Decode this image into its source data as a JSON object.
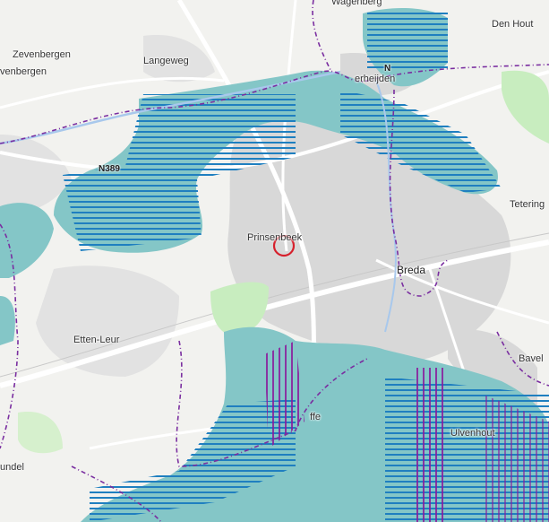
{
  "map": {
    "places": [
      {
        "id": "wagenberg",
        "name": "Wagenberg"
      },
      {
        "id": "den-hout",
        "name": "Den Hout"
      },
      {
        "id": "zevenbergen",
        "name": "Zevenbergen"
      },
      {
        "id": "langeweg",
        "name": "Langeweg"
      },
      {
        "id": "zevenbergen-partial",
        "name": "venbergen"
      },
      {
        "id": "terheijden",
        "name": "erheijden"
      },
      {
        "id": "teteringen",
        "name": "Tetering"
      },
      {
        "id": "prinsenbeek",
        "name": "Prinsenbeek"
      },
      {
        "id": "breda",
        "name": "Breda"
      },
      {
        "id": "etten-leur",
        "name": "Etten-Leur"
      },
      {
        "id": "bavel",
        "name": "Bavel"
      },
      {
        "id": "effen",
        "name": "ffe"
      },
      {
        "id": "ulvenhout",
        "name": "Ulvenhout"
      },
      {
        "id": "rucphen-partial",
        "name": "undel"
      }
    ],
    "roads": [
      {
        "id": "n389",
        "label": "N389"
      },
      {
        "id": "n-road",
        "label": "N"
      }
    ],
    "colors": {
      "background": "#f2f2ef",
      "urban": "#d9d9d9",
      "flood_zone": "#84c6c7",
      "green": "#c9edc1",
      "hatch": "#1f7fc0",
      "boundary": "#7a2ea0",
      "marker": "#d6202c",
      "river": "#a8c8ec",
      "road": "#ffffff"
    },
    "marker": {
      "shape": "circle",
      "label": "selected-location"
    }
  }
}
